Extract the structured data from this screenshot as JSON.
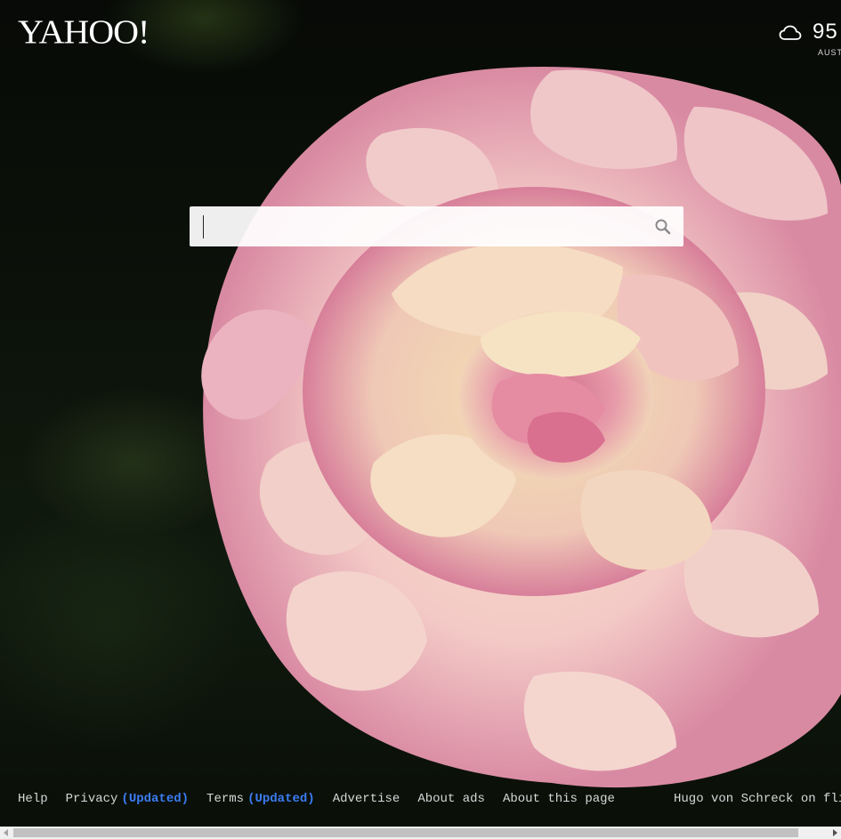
{
  "header": {
    "logo_text": "YAHOO!",
    "weather": {
      "icon": "cloud-icon",
      "temperature": "95",
      "city": "AUSTIN"
    }
  },
  "search": {
    "value": "",
    "placeholder": "",
    "button_icon": "search-icon"
  },
  "footer": {
    "links": {
      "help": "Help",
      "privacy": "Privacy",
      "privacy_updated": "(Updated)",
      "terms": "Terms",
      "terms_updated": "(Updated)",
      "advertise": "Advertise",
      "about_ads": "About ads",
      "about_page": "About this page"
    },
    "photo_credit": "Hugo von Schreck on flickr"
  },
  "colors": {
    "updated_link": "#3b7cf3",
    "footer_text": "#d7d7d7"
  }
}
